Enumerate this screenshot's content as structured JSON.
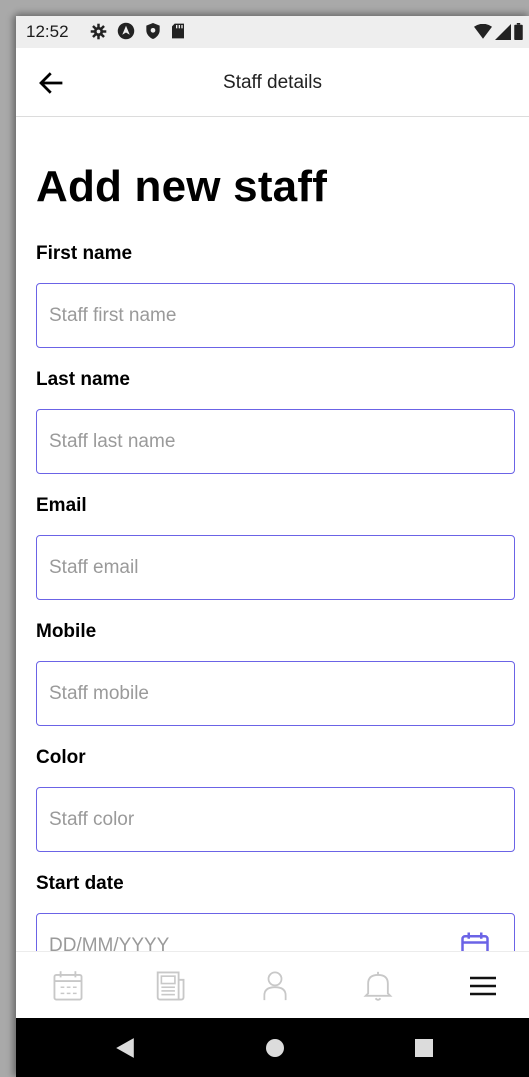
{
  "status_bar": {
    "time": "12:52"
  },
  "header": {
    "title": "Staff details"
  },
  "page": {
    "title": "Add new staff"
  },
  "form": {
    "first_name": {
      "label": "First name",
      "placeholder": "Staff first name",
      "value": ""
    },
    "last_name": {
      "label": "Last name",
      "placeholder": "Staff last name",
      "value": ""
    },
    "email": {
      "label": "Email",
      "placeholder": "Staff email",
      "value": ""
    },
    "mobile": {
      "label": "Mobile",
      "placeholder": "Staff mobile",
      "value": ""
    },
    "color": {
      "label": "Color",
      "placeholder": "Staff color",
      "value": ""
    },
    "start_date": {
      "label": "Start date",
      "placeholder": "DD/MM/YYYY",
      "value": ""
    }
  },
  "bottom_nav": {
    "items": [
      {
        "icon": "calendar-icon",
        "active": false
      },
      {
        "icon": "newspaper-icon",
        "active": false
      },
      {
        "icon": "person-icon",
        "active": false
      },
      {
        "icon": "bell-icon",
        "active": false
      },
      {
        "icon": "menu-icon",
        "active": true
      }
    ]
  },
  "colors": {
    "accent": "#6b63e6",
    "inactive_icon": "#c8c8c8",
    "text": "#000000",
    "placeholder": "#9a9a9a"
  }
}
